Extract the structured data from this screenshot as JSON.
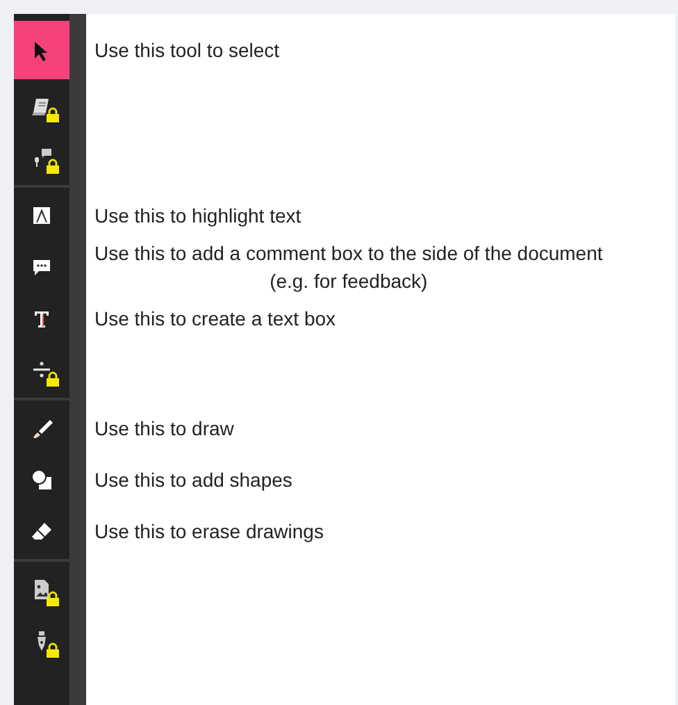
{
  "toolbar": {
    "groups": [
      {
        "tools": [
          {
            "kind": "select",
            "selected": true,
            "locked": false,
            "description": "Use this tool to select"
          },
          {
            "kind": "book",
            "selected": false,
            "locked": true
          },
          {
            "kind": "voice",
            "selected": false,
            "locked": true
          }
        ]
      },
      {
        "tools": [
          {
            "kind": "highlight",
            "selected": false,
            "locked": false,
            "description": "Use this to highlight text"
          },
          {
            "kind": "comment",
            "selected": false,
            "locked": false,
            "description": "Use this to add a comment box to the side of the document\n(e.g. for feedback)"
          },
          {
            "kind": "text",
            "selected": false,
            "locked": false,
            "description": "Use this to create a text box"
          },
          {
            "kind": "divide",
            "selected": false,
            "locked": true
          }
        ]
      },
      {
        "tools": [
          {
            "kind": "draw",
            "selected": false,
            "locked": false,
            "description": "Use this to draw"
          },
          {
            "kind": "shapes",
            "selected": false,
            "locked": false,
            "description": "Use this to add shapes"
          },
          {
            "kind": "erase",
            "selected": false,
            "locked": false,
            "description": "Use this to erase drawings"
          }
        ]
      },
      {
        "tools": [
          {
            "kind": "image",
            "selected": false,
            "locked": true
          },
          {
            "kind": "pen",
            "selected": false,
            "locked": true
          }
        ]
      }
    ]
  }
}
